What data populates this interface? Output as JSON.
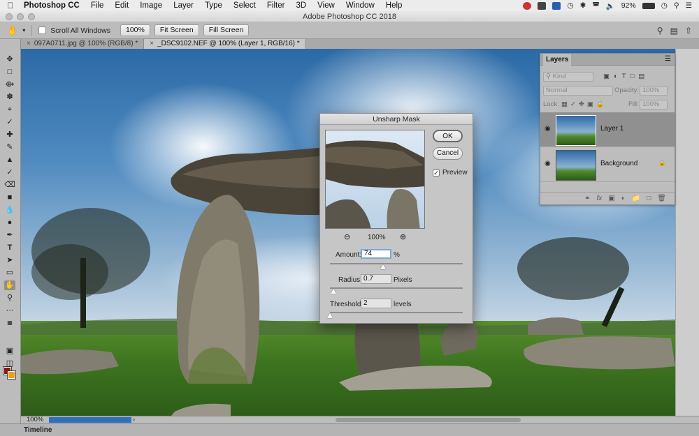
{
  "menubar": {
    "app": "Photoshop CC",
    "items": [
      "File",
      "Edit",
      "Image",
      "Layer",
      "Type",
      "Select",
      "Filter",
      "3D",
      "View",
      "Window",
      "Help"
    ],
    "battery": "92%"
  },
  "window": {
    "title": "Adobe Photoshop CC 2018"
  },
  "options": {
    "scroll_all_windows": "Scroll All Windows",
    "zoom_value": "100%",
    "fit_screen": "Fit Screen",
    "fill_screen": "Fill Screen"
  },
  "tabs": [
    {
      "label": "097A0711.jpg @ 100% (RGB/8) *",
      "close": "×"
    },
    {
      "label": "_DSC9102.NEF @ 100% (Layer 1, RGB/16) *",
      "close": "×"
    }
  ],
  "status": {
    "zoom": "100%",
    "arrow": "›"
  },
  "timeline": {
    "label": "Timeline"
  },
  "layers_panel": {
    "title": "Layers",
    "filter_kind": "Kind",
    "blend_mode": "Normal",
    "opacity_label": "Opacity:",
    "opacity_value": "100%",
    "lock_label": "Lock:",
    "fill_label": "Fill:",
    "fill_value": "100%",
    "layers": [
      {
        "name": "Layer 1",
        "selected": true
      },
      {
        "name": "Background",
        "selected": false
      }
    ]
  },
  "dialog": {
    "title": "Unsharp Mask",
    "ok": "OK",
    "cancel": "Cancel",
    "preview_label": "Preview",
    "preview_checked": true,
    "zoom": "100%",
    "amount_label": "Amount:",
    "amount_value": "74",
    "amount_unit": "%",
    "radius_label": "Radius:",
    "radius_value": "0.7",
    "radius_unit": "Pixels",
    "threshold_label": "Threshold:",
    "threshold_value": "2",
    "threshold_unit": "levels"
  }
}
